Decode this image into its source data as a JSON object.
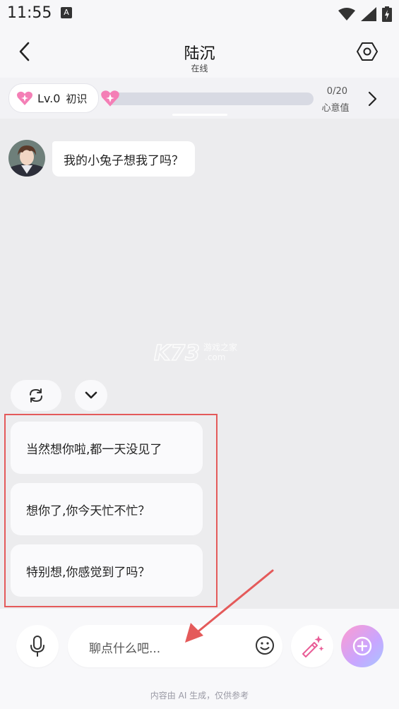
{
  "status_bar": {
    "time": "11:55",
    "notification_icon": "A"
  },
  "header": {
    "title": "陆沉",
    "subtitle": "在线"
  },
  "level": {
    "level_label": "Lv.0",
    "stage_label": "初识",
    "affection_current": 0,
    "affection_max": 20,
    "affection_text": "0/20",
    "affection_label": "心意值"
  },
  "chat": {
    "messages": [
      {
        "sender": "陆沉",
        "text": "我的小兔子想我了吗？"
      }
    ]
  },
  "watermark": {
    "brand": "K73",
    "site_cn": "游戏之家",
    "site_domain": ".com"
  },
  "suggestions": [
    "当然想你啦,都一天没见了",
    "想你了,你今天忙不忙？",
    "特别想,你感觉到了吗？"
  ],
  "input": {
    "placeholder": "聊点什么吧..."
  },
  "footer": {
    "disclaimer": "内容由 AI 生成，仅供参考"
  },
  "colors": {
    "accent_pink": "#f47fb6",
    "highlight_frame": "#e45a5a",
    "background": "#ececee"
  },
  "icons": [
    "signal-icon",
    "wifi-icon",
    "battery-icon",
    "back-icon",
    "settings-icon",
    "heart-icon",
    "chevron-right-icon",
    "refresh-icon",
    "chevron-down-icon",
    "mic-icon",
    "emoji-icon",
    "magic-wand-icon",
    "plus-icon"
  ]
}
